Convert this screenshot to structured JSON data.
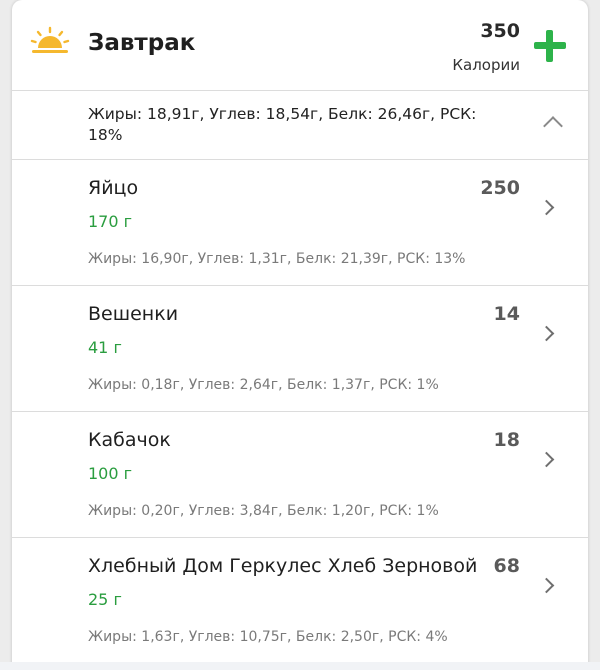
{
  "meal": {
    "title": "Завтрак",
    "calories": "350",
    "calories_label": "Калории",
    "summary": "Жиры: 18,91г, Углев: 18,54г, Белк: 26,46г, РСК: 18%"
  },
  "items": [
    {
      "name": "Яйцо",
      "calories": "250",
      "amount": "170 г",
      "macros": "Жиры: 16,90г, Углев: 1,31г, Белк: 21,39г, РСК: 13%"
    },
    {
      "name": "Вешенки",
      "calories": "14",
      "amount": "41 г",
      "macros": "Жиры: 0,18г, Углев: 2,64г, Белк: 1,37г, РСК: 1%"
    },
    {
      "name": "Кабачок",
      "calories": "18",
      "amount": "100 г",
      "macros": "Жиры: 0,20г, Углев: 3,84г, Белк: 1,20г, РСК: 1%"
    },
    {
      "name": "Хлебный Дом Геркулес Хлеб Зерновой",
      "calories": "68",
      "amount": "25 г",
      "macros": "Жиры: 1,63г, Углев: 10,75г, Белк: 2,50г, РСК: 4%"
    }
  ],
  "colors": {
    "accent_green": "#2db34a",
    "amount_green": "#2a9d3f",
    "sun_yellow": "#f5b82e"
  },
  "icons": {
    "meal_icon": "sunrise-icon",
    "add": "plus-icon",
    "collapse": "chevron-up-icon",
    "open": "chevron-right-icon"
  }
}
